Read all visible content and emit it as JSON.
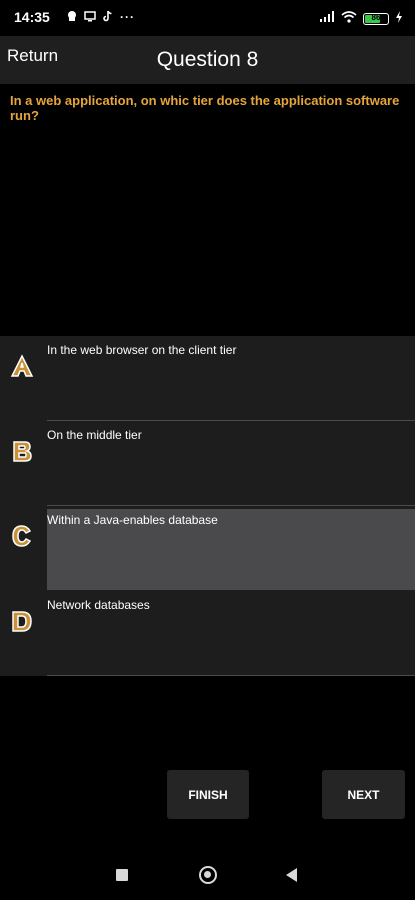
{
  "status_bar": {
    "time": "14:35",
    "battery_level": "86",
    "left_icons": [
      "app-icon",
      "screen-icon",
      "tiktok-icon",
      "more-icon"
    ],
    "right_icons": [
      "signal-icon",
      "wifi-icon",
      "battery-icon",
      "charging-icon"
    ]
  },
  "header": {
    "return_label": "Return",
    "title": "Question 8"
  },
  "question": {
    "text": "In a web application, on whic tier does the application software run?"
  },
  "answers": [
    {
      "letter": "A",
      "text": "In the web browser on the client tier",
      "selected": false
    },
    {
      "letter": "B",
      "text": "On the middle tier",
      "selected": false
    },
    {
      "letter": "C",
      "text": "Within a Java-enables database",
      "selected": true
    },
    {
      "letter": "D",
      "text": "Network databases",
      "selected": false
    }
  ],
  "buttons": {
    "finish": "FINISH",
    "next": "NEXT"
  },
  "colors": {
    "accent": "#e6a53a",
    "selected_bg": "#4a4a4c"
  }
}
